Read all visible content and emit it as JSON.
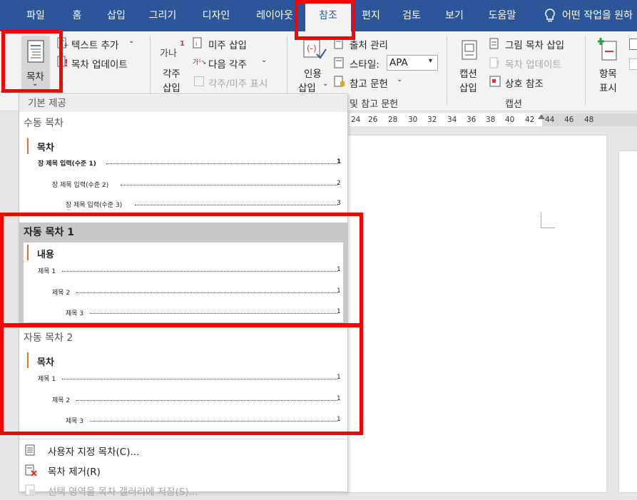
{
  "tabs": [
    "파일",
    "홈",
    "삽입",
    "그리기",
    "디자인",
    "레이아웃",
    "참조",
    "편지",
    "검토",
    "보기",
    "도움말",
    "어떤 작업을 원하"
  ],
  "ribbon": {
    "toc_button": "목차",
    "add_text": "텍스트 추가",
    "update_toc": "목차 업데이트",
    "footnote_icon": "가나",
    "insert_footnote": [
      "각주",
      "삽입"
    ],
    "insert_endnote": "미주 삽입",
    "next_footnote": "다음 각주",
    "show_notes": "각주/미주 표시",
    "insert_citation": [
      "인용",
      "삽입"
    ],
    "manage_sources": "출처 관리",
    "style_label": "스타일:",
    "style_value": "APA",
    "bibliography": "참고 문헌",
    "group_citations": "인용 및 참고 문헌",
    "insert_caption": [
      "캡션",
      "삽입"
    ],
    "insert_tof": "그림 목차 삽입",
    "update_table": "목차 업데이트",
    "cross_ref": "상호 참조",
    "group_captions": "캡션",
    "mark_entry": [
      "항목",
      "표시"
    ]
  },
  "ruler_ticks": [
    "24",
    "26",
    "28",
    "30",
    "32",
    "34",
    "36",
    "38",
    "40",
    "42",
    "44",
    "46",
    "48"
  ],
  "dropdown": {
    "header": "기본 제공",
    "manual": {
      "title": "수동 목차",
      "heading": "목차",
      "lines": [
        {
          "text": "장 제목 입력(수준 1)",
          "page": "1",
          "bold": true
        },
        {
          "text": "장 제목 입력(수준 2)",
          "page": "2",
          "bold": false
        },
        {
          "text": "장 제목 입력(수준 3)",
          "page": "3",
          "bold": false
        }
      ]
    },
    "auto1": {
      "title": "자동 목차 1",
      "heading": "내용",
      "lines": [
        {
          "text": "제목 1",
          "page": "1"
        },
        {
          "text": "제목 2",
          "page": "1"
        },
        {
          "text": "제목 3",
          "page": "1"
        }
      ]
    },
    "auto2": {
      "title": "자동 목차 2",
      "heading": "목차",
      "lines": [
        {
          "text": "제목 1",
          "page": "1"
        },
        {
          "text": "제목 2",
          "page": "1"
        },
        {
          "text": "제목 3",
          "page": "1"
        }
      ]
    },
    "menu": {
      "custom_toc": "사용자 지정 목차(C)...",
      "remove_toc": "목차 제거(R)",
      "save_selection": "선택 영역을 목차 갤러리에 저장(S)..."
    }
  },
  "colors": {
    "tabbar": "#2b579a",
    "highlight": "#ff0000",
    "accent": "#e07020"
  }
}
